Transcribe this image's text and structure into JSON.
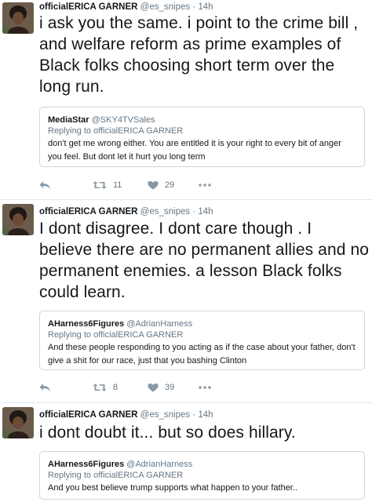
{
  "tweets": [
    {
      "name": "officialERICA GARNER",
      "handle": "@es_snipes",
      "sep": "·",
      "time": "14h",
      "text": "i ask you the same. i point to the crime bill , and welfare reform as prime examples of Black folks choosing short term over the long run.",
      "quote": {
        "name": "MediaStar",
        "handle": "@SKY4TVSales",
        "replying": "Replying to officialERICA GARNER",
        "text": "don't get me wrong either. You are entitled it is your right to every bit of anger you feel. But dont let it hurt you long term"
      },
      "retweets": "11",
      "likes": "29"
    },
    {
      "name": "officialERICA GARNER",
      "handle": "@es_snipes",
      "sep": "·",
      "time": "14h",
      "text": "I dont disagree. I dont care though . I believe there are no permanent allies and no permanent enemies. a lesson Black folks could learn.",
      "quote": {
        "name": "AHarness6Figures",
        "handle": "@AdrianHarness",
        "replying": "Replying to officialERICA GARNER",
        "text": "And these people responding to you acting as if the case about your father, don't give a shit for our race, just that you bashing Clinton"
      },
      "retweets": "8",
      "likes": "39"
    },
    {
      "name": "officialERICA GARNER",
      "handle": "@es_snipes",
      "sep": "·",
      "time": "14h",
      "text": "i dont doubt it... but so does hillary.",
      "quote": {
        "name": "AHarness6Figures",
        "handle": "@AdrianHarness",
        "replying": "Replying to officialERICA GARNER",
        "text": "And you best believe trump supports what happen to your father.."
      }
    }
  ],
  "icons": [
    "reply-icon",
    "retweet-icon",
    "like-icon",
    "more-icon"
  ],
  "colors": {
    "text": "#14171a",
    "secondary": "#657786",
    "border": "#ccd6dd",
    "icon": "#8899a6"
  }
}
